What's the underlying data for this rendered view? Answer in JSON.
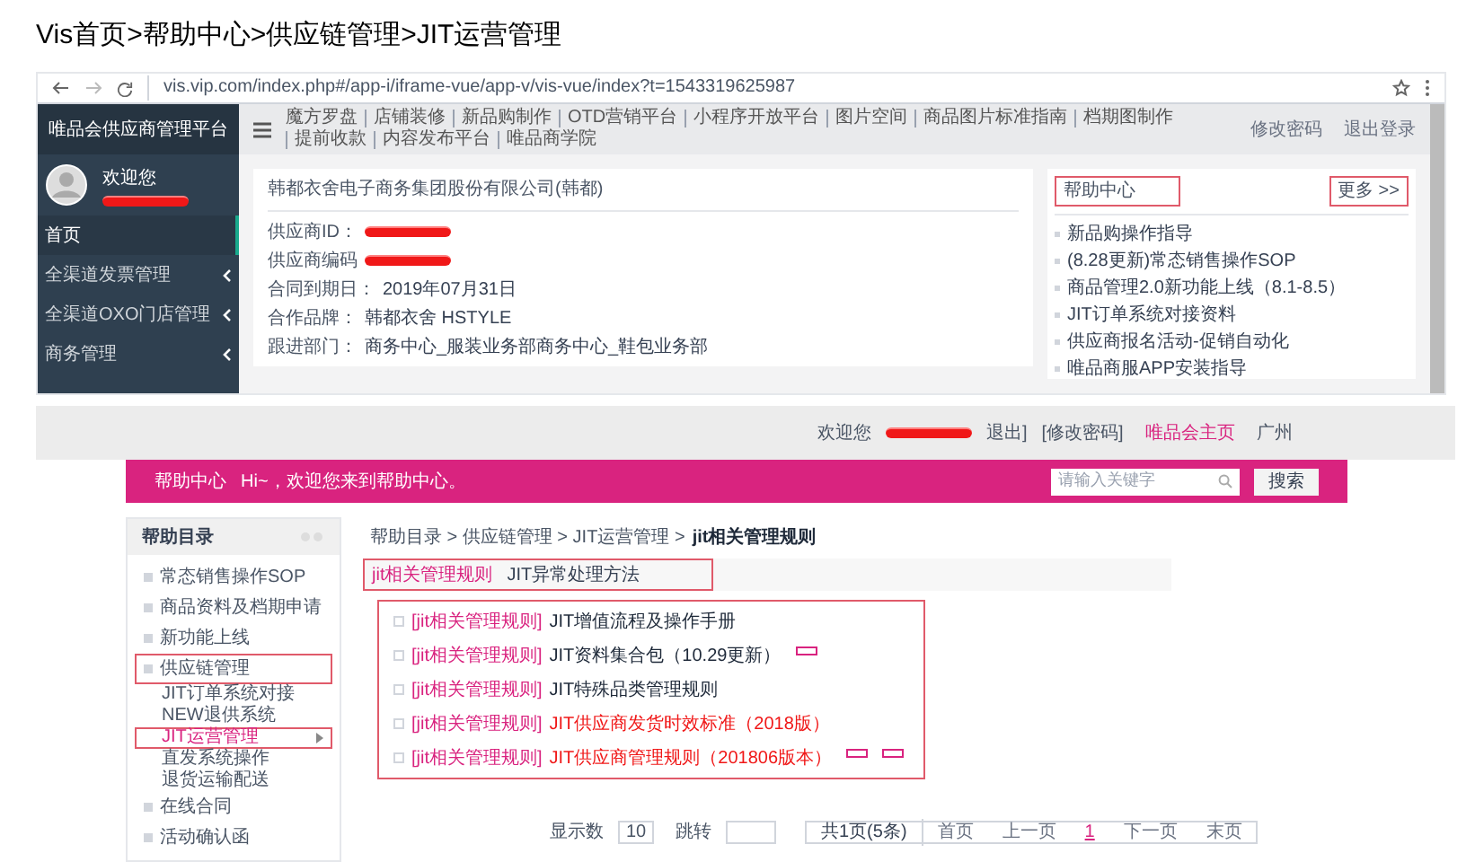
{
  "page_title": "Vis首页>帮助中心>供应链管理>JIT运营管理",
  "screenshot_1": {
    "browser": {
      "url": "vis.vip.com/index.php#/app-i/iframe-vue/app-v/vis-vue/index?t=1543319625987"
    },
    "sidebar": {
      "title": "唯品会供应商管理平台",
      "greeting": "欢迎您",
      "user_redacted": true,
      "items": [
        {
          "label": "首页",
          "selected": true,
          "expandable": false
        },
        {
          "label": "全渠道发票管理",
          "selected": false,
          "expandable": true
        },
        {
          "label": "全渠道OXO门店管理",
          "selected": false,
          "expandable": true
        },
        {
          "label": "商务管理",
          "selected": false,
          "expandable": true
        }
      ]
    },
    "top_nav": {
      "links": [
        "魔方罗盘",
        "店铺装修",
        "新品购制作",
        "OTD营销平台",
        "小程序开放平台",
        "图片空间",
        "商品图片标准指南",
        "档期图制作",
        "提前收款",
        "内容发布平台",
        "唯品商学院"
      ],
      "actions": [
        "修改密码",
        "退出登录"
      ]
    },
    "company_card": {
      "name": "韩都衣舍电子商务集团股份有限公司(韩都)",
      "fields": [
        {
          "label": "供应商ID：",
          "value_redacted": true
        },
        {
          "label": "供应商编码",
          "value_redacted": true
        },
        {
          "label": "合同到期日：",
          "value": "2019年07月31日",
          "value_redacted": false
        },
        {
          "label": "合作品牌：",
          "value": "韩都衣舍 HSTYLE",
          "value_redacted": false
        },
        {
          "label": "跟进部门：",
          "value": "商务中心_服装业务部商务中心_鞋包业务部",
          "value_redacted": false
        }
      ]
    },
    "help_panel": {
      "title": "帮助中心",
      "title_highlighted": true,
      "more": "更多 >>",
      "more_highlighted": true,
      "links": [
        "新品购操作指导",
        "(8.28更新)常态销售操作SOP",
        "商品管理2.0新功能上线（8.1-8.5）",
        "JIT订单系统对接资料",
        "供应商报名活动-促销自动化",
        "唯品商服APP安装指导"
      ]
    }
  },
  "screenshot_2": {
    "top_bar": {
      "welcome": "欢迎您",
      "user_redacted": true,
      "logout": "退出]",
      "change_password": "[修改密码]",
      "home_link": "唯品会主页",
      "city": "广州"
    },
    "header": {
      "title": "帮助中心",
      "greeting": "Hi~，欢迎您来到帮助中心。",
      "search_placeholder": "请输入关键字",
      "search_button": "搜索"
    },
    "sidebar": {
      "title": "帮助目录",
      "items": [
        {
          "label": "常态销售操作SOP",
          "highlighted": false
        },
        {
          "label": "商品资料及档期申请",
          "highlighted": false
        },
        {
          "label": "新功能上线",
          "highlighted": false
        },
        {
          "label": "供应链管理",
          "highlighted": true,
          "children": [
            {
              "label": "JIT订单系统对接",
              "selected": false
            },
            {
              "label": "NEW退供系统",
              "selected": false
            },
            {
              "label": "JIT运营管理",
              "selected": true
            },
            {
              "label": "直发系统操作",
              "selected": false
            },
            {
              "label": "退货运输配送",
              "selected": false
            }
          ]
        },
        {
          "label": "在线合同",
          "highlighted": false
        },
        {
          "label": "活动确认函",
          "highlighted": false
        }
      ]
    },
    "breadcrumb": {
      "path": "帮助目录 > 供应链管理 > JIT运营管理 >",
      "current": "jit相关管理规则"
    },
    "tabs": [
      {
        "label": "jit相关管理规则",
        "selected": true
      },
      {
        "label": "JIT异常处理方法",
        "selected": false
      }
    ],
    "articles": [
      {
        "category": "[jit相关管理规则]",
        "title": "JIT增值流程及操作手册",
        "emphasized": false,
        "first_badge": false,
        "second_badge": false
      },
      {
        "category": "[jit相关管理规则]",
        "title": "JIT资料集合包（10.29更新）",
        "emphasized": false,
        "first_badge": true,
        "second_badge": false
      },
      {
        "category": "[jit相关管理规则]",
        "title": "JIT特殊品类管理规则",
        "emphasized": false,
        "first_badge": false,
        "second_badge": false
      },
      {
        "category": "[jit相关管理规则]",
        "title": "JIT供应商发货时效标准（2018版）",
        "emphasized": true,
        "first_badge": false,
        "second_badge": false
      },
      {
        "category": "[jit相关管理规则]",
        "title": "JIT供应商管理规则（201806版本）",
        "emphasized": true,
        "first_badge": true,
        "second_badge": true
      }
    ],
    "pagination": {
      "page_size_label": "显示数",
      "page_size": "10",
      "jump_label": "跳转",
      "summary": "共1页(5条)",
      "pages": [
        {
          "label": "首页",
          "selected": false
        },
        {
          "label": "上一页",
          "selected": false
        },
        {
          "label": "1",
          "selected": true
        },
        {
          "label": "下一页",
          "selected": false
        },
        {
          "label": "末页",
          "selected": false
        }
      ]
    }
  }
}
